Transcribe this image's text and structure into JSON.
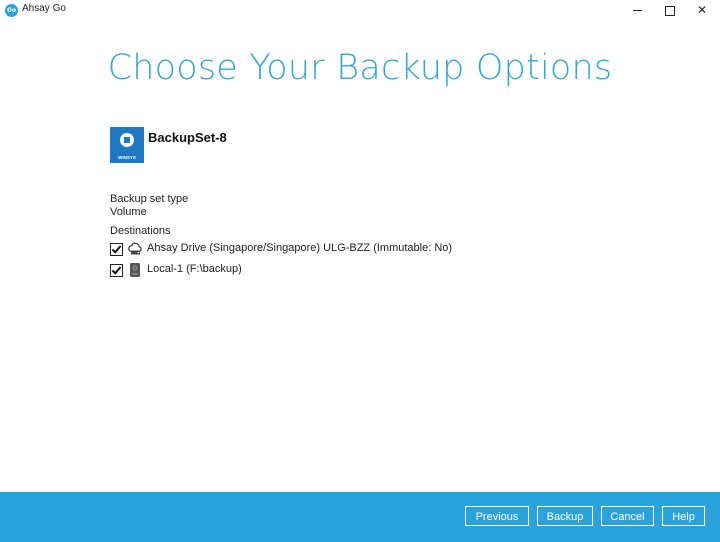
{
  "window": {
    "app_icon_text": "Go",
    "title": "Ahsay Go",
    "minimize": "minimize",
    "maximize": "maximize",
    "close": "✕"
  },
  "page": {
    "title": "Choose Your Backup Options"
  },
  "backup_set": {
    "name": "BackupSet-8",
    "icon_label": "WINSYS",
    "icon": "windows-system-icon"
  },
  "details": {
    "type_label": "Backup set type",
    "type_value": "Volume",
    "destinations_label": "Destinations"
  },
  "destinations": [
    {
      "checked": true,
      "icon": "cloud-drive-icon",
      "label": "Ahsay Drive (Singapore/Singapore) ULG-BZZ (Immutable: No)"
    },
    {
      "checked": true,
      "icon": "local-drive-icon",
      "label": "Local-1 (F:\\backup)"
    }
  ],
  "footer": {
    "previous": "Previous",
    "backup": "Backup",
    "cancel": "Cancel",
    "help": "Help"
  },
  "colors": {
    "accent": "#2aa3dc",
    "title": "#3aa6d0",
    "set_icon": "#1f78c1"
  }
}
